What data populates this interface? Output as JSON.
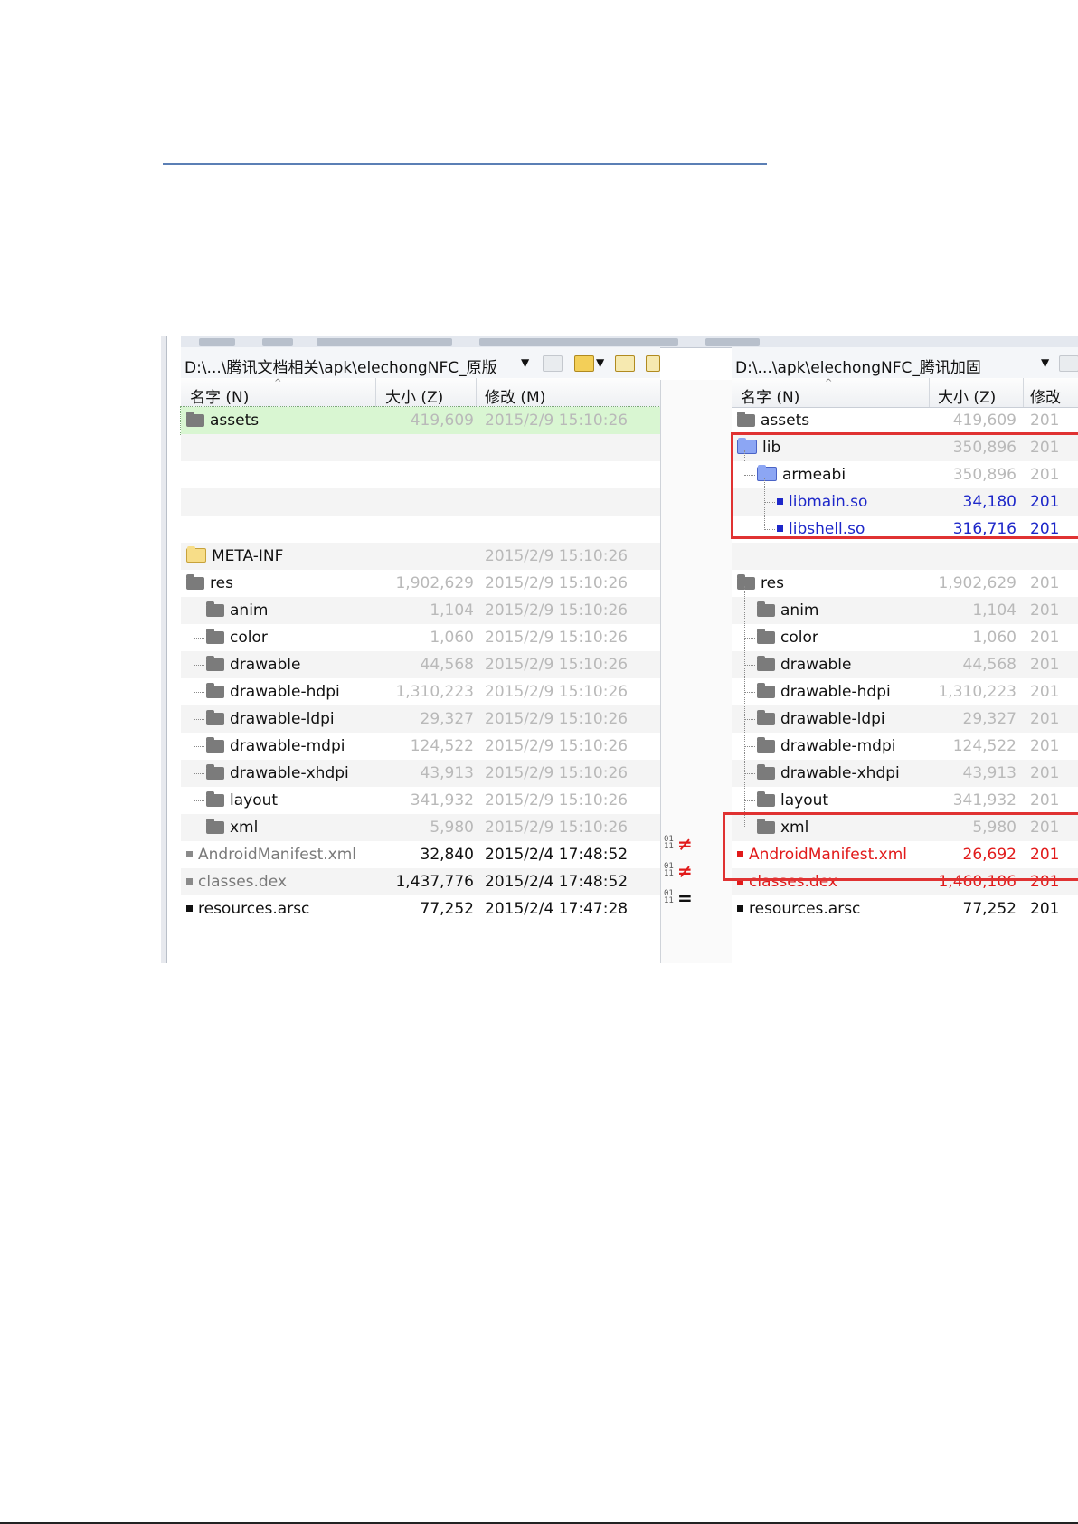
{
  "left_pane": {
    "path": "D:\\...\\腾讯文档相关\\apk\\elechongNFC_原版",
    "columns": {
      "name": "名字 (N)",
      "size": "大小 (Z)",
      "modified": "修改 (M)"
    },
    "rows": [
      {
        "name": "assets",
        "kind": "folder",
        "size": "419,609",
        "date": "2015/2/9 15:10:26"
      },
      {
        "name": "",
        "kind": "blank"
      },
      {
        "name": "",
        "kind": "blank"
      },
      {
        "name": "",
        "kind": "blank"
      },
      {
        "name": "",
        "kind": "blank"
      },
      {
        "name": "META-INF",
        "kind": "folder",
        "size": "",
        "date": "2015/2/9 15:10:26"
      },
      {
        "name": "res",
        "kind": "folder",
        "size": "1,902,629",
        "date": "2015/2/9 15:10:26"
      },
      {
        "name": "anim",
        "kind": "folder",
        "size": "1,104",
        "date": "2015/2/9 15:10:26"
      },
      {
        "name": "color",
        "kind": "folder",
        "size": "1,060",
        "date": "2015/2/9 15:10:26"
      },
      {
        "name": "drawable",
        "kind": "folder",
        "size": "44,568",
        "date": "2015/2/9 15:10:26"
      },
      {
        "name": "drawable-hdpi",
        "kind": "folder",
        "size": "1,310,223",
        "date": "2015/2/9 15:10:26"
      },
      {
        "name": "drawable-ldpi",
        "kind": "folder",
        "size": "29,327",
        "date": "2015/2/9 15:10:26"
      },
      {
        "name": "drawable-mdpi",
        "kind": "folder",
        "size": "124,522",
        "date": "2015/2/9 15:10:26"
      },
      {
        "name": "drawable-xhdpi",
        "kind": "folder",
        "size": "43,913",
        "date": "2015/2/9 15:10:26"
      },
      {
        "name": "layout",
        "kind": "folder",
        "size": "341,932",
        "date": "2015/2/9 15:10:26"
      },
      {
        "name": "xml",
        "kind": "folder",
        "size": "5,980",
        "date": "2015/2/9 15:10:26"
      },
      {
        "name": "AndroidManifest.xml",
        "kind": "file",
        "size": "32,840",
        "date": "2015/2/4 17:48:52"
      },
      {
        "name": "classes.dex",
        "kind": "file",
        "size": "1,437,776",
        "date": "2015/2/4 17:48:52"
      },
      {
        "name": "resources.arsc",
        "kind": "file",
        "size": "77,252",
        "date": "2015/2/4 17:47:28"
      }
    ]
  },
  "right_pane": {
    "path": "D:\\...\\apk\\elechongNFC_腾讯加固",
    "columns": {
      "name": "名字 (N)",
      "size": "大小 (Z)",
      "modified": "修改"
    },
    "rows": [
      {
        "name": "assets",
        "kind": "folder",
        "size": "419,609",
        "date": "201"
      },
      {
        "name": "lib",
        "kind": "folder",
        "size": "350,896",
        "date": "201"
      },
      {
        "name": "armeabi",
        "kind": "folder",
        "size": "350,896",
        "date": "201"
      },
      {
        "name": "libmain.so",
        "kind": "file",
        "size": "34,180",
        "date": "201"
      },
      {
        "name": "libshell.so",
        "kind": "file",
        "size": "316,716",
        "date": "201"
      },
      {
        "name": "",
        "kind": "blank"
      },
      {
        "name": "res",
        "kind": "folder",
        "size": "1,902,629",
        "date": "201"
      },
      {
        "name": "anim",
        "kind": "folder",
        "size": "1,104",
        "date": "201"
      },
      {
        "name": "color",
        "kind": "folder",
        "size": "1,060",
        "date": "201"
      },
      {
        "name": "drawable",
        "kind": "folder",
        "size": "44,568",
        "date": "201"
      },
      {
        "name": "drawable-hdpi",
        "kind": "folder",
        "size": "1,310,223",
        "date": "201"
      },
      {
        "name": "drawable-ldpi",
        "kind": "folder",
        "size": "29,327",
        "date": "201"
      },
      {
        "name": "drawable-mdpi",
        "kind": "folder",
        "size": "124,522",
        "date": "201"
      },
      {
        "name": "drawable-xhdpi",
        "kind": "folder",
        "size": "43,913",
        "date": "201"
      },
      {
        "name": "layout",
        "kind": "folder",
        "size": "341,932",
        "date": "201"
      },
      {
        "name": "xml",
        "kind": "folder",
        "size": "5,980",
        "date": "201"
      },
      {
        "name": "AndroidManifest.xml",
        "kind": "file",
        "size": "26,692",
        "date": "201"
      },
      {
        "name": "classes.dex",
        "kind": "file",
        "size": "1,460,106",
        "date": "201"
      },
      {
        "name": "resources.arsc",
        "kind": "file",
        "size": "77,252",
        "date": "201"
      }
    ]
  },
  "compare": [
    {
      "symbol": "≠",
      "status": "different"
    },
    {
      "symbol": "≠",
      "status": "different"
    },
    {
      "symbol": "=",
      "status": "identical"
    }
  ],
  "colors": {
    "identical": "#b9b9b9",
    "orphan": "#1d27c9",
    "different": "#e11a1a",
    "highlight_box": "#e03232",
    "selected_row": "#d9f6d2"
  },
  "icons": [
    "folder-icon",
    "open-folder-icon",
    "file-icon",
    "dropdown-arrow-icon",
    "folder-browse-icon",
    "folder-up-icon",
    "folder-root-icon"
  ]
}
